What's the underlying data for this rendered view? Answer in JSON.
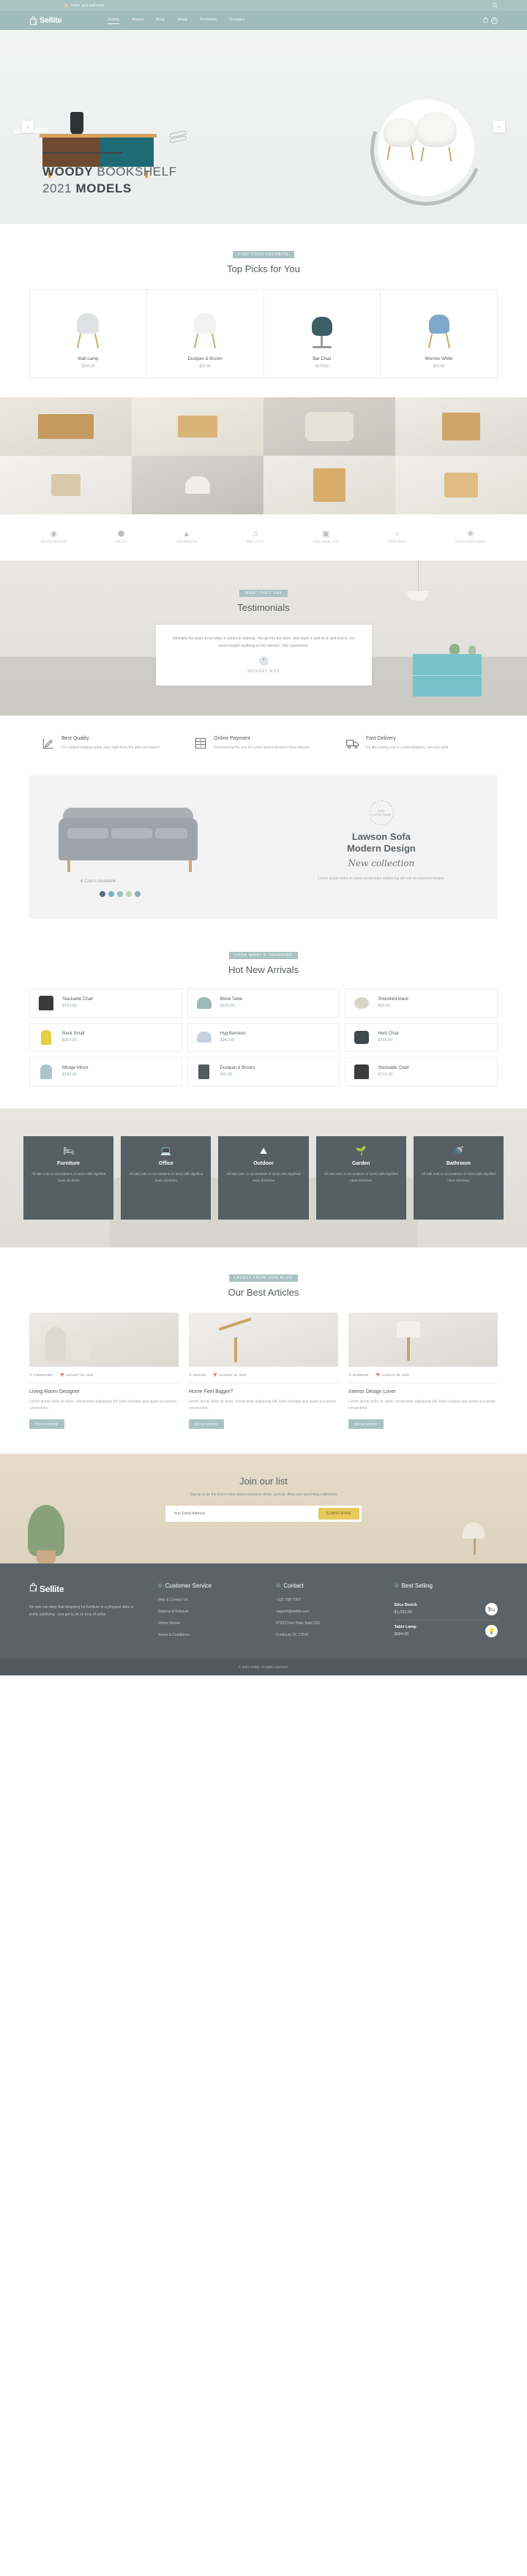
{
  "topbar": {
    "greeting": "Hello and welcome",
    "search_icon": "search-icon"
  },
  "nav": {
    "brand": "Sellite",
    "links": [
      {
        "label": "Home",
        "active": true
      },
      {
        "label": "About",
        "active": false
      },
      {
        "label": "Blog",
        "active": false
      },
      {
        "label": "Shop",
        "active": false
      },
      {
        "label": "Portfolio",
        "active": false
      },
      {
        "label": "Contact",
        "active": false
      }
    ],
    "cart_count": "0"
  },
  "hero": {
    "title_bold": "WOODY",
    "title_rest": " BOOKSHELF",
    "title_line2_light": "2021 ",
    "title_line2_bold": "MODELS",
    "prev": "‹",
    "next": "›"
  },
  "top_picks": {
    "badge": "FIND YOUR FAVORITE",
    "title": "Top Picks for You",
    "products": [
      {
        "name": "Wall Lamp",
        "price": "$100.00"
      },
      {
        "name": "Dustpan & Broom",
        "price": "$32.00"
      },
      {
        "name": "Bar Chair",
        "price": "$170.00"
      },
      {
        "name": "Mormor White",
        "price": "$20.00"
      }
    ]
  },
  "brands": [
    {
      "glyph": "◉",
      "label": "WOODMARK"
    },
    {
      "glyph": "⬢",
      "label": "HEXA"
    },
    {
      "glyph": "▲",
      "label": "TRIANGLE"
    },
    {
      "glyph": "♫",
      "label": "MELODY"
    },
    {
      "glyph": "▣",
      "label": "SQUARE CO"
    },
    {
      "glyph": "○",
      "label": "ORBIANT"
    },
    {
      "glyph": "❀",
      "label": "GOLDEN LEAF"
    }
  ],
  "testimonials": {
    "badge": "WHAT THEY SAY",
    "title": "Testimonials",
    "quote": "Definitely the place to be when it comes to makeup. You go into the store, and reach it, and try it, and love it. I've never bought anything on the Internet. I like experience.",
    "author": "JEFFREY ROY",
    "avatar_icon": "quote-icon"
  },
  "features": [
    {
      "icon": "ruler-pencil-icon",
      "title": "Best Quality",
      "desc": "It's content strategy gone awry right from the start are wasn't."
    },
    {
      "icon": "cabinet-icon",
      "title": "Online Payment",
      "desc": "Forswearing the use of Lorem Ipsum wouldn't have helped."
    },
    {
      "icon": "delivery-truck-icon",
      "title": "Fast Delivery",
      "desc": "It's like saying you're a bad designer, use less bold"
    }
  ],
  "sofa_banner": {
    "seal": "FOR FURNITURE",
    "title_line1": "Lawson Sofa",
    "title_line2": "Modern Design",
    "script": "New collection",
    "desc": "Lorem ipsum dolor sit amet consectetur adipiscing elit sed do eiusmod tempor.",
    "colors_label": "6 Colors Available",
    "colors": [
      "#5f6c8c",
      "#7cb0c4",
      "#93c3ba",
      "#bcd4a8",
      "#8ba9c2"
    ]
  },
  "arrivals": {
    "badge": "LOOK WHAT'S TRENDING",
    "title": "Hot New Arrivals",
    "products": [
      {
        "name": "Stackable Chair",
        "price": "$712.00",
        "color": "#3b3b3b"
      },
      {
        "name": "Block Table",
        "price": "$230.00",
        "color": "#9dbbb6"
      },
      {
        "name": "Shorebird black",
        "price": "$35.00",
        "color": "#d9d4c8"
      },
      {
        "name": "Rack Small",
        "price": "$310.00",
        "color": "#e3cf3f"
      },
      {
        "name": "Hyg Barstool",
        "price": "$342.00",
        "color": "#c8cfe0"
      },
      {
        "name": "Herit Chair",
        "price": "$725.00",
        "color": "#3f484c"
      },
      {
        "name": "Mirage Mirror",
        "price": "$190.00",
        "color": "#adc4c9"
      },
      {
        "name": "Dustpan & Broom",
        "price": "$32.00",
        "color": "#555a5d"
      },
      {
        "name": "Stackable Chair",
        "price": "$712.00",
        "color": "#3b3b3b"
      }
    ]
  },
  "categories": [
    {
      "icon": "sofa-icon",
      "name": "Furniture",
      "desc": "All sale note on accusations of racist calls dignified news doctrines"
    },
    {
      "icon": "desk-icon",
      "name": "Office",
      "desc": "All sale note on accusations of racist calls dignified news doctrines"
    },
    {
      "icon": "parasol-icon",
      "name": "Outdoor",
      "desc": "All sale note on accusations of racist calls dignified news doctrines"
    },
    {
      "icon": "plant-icon",
      "name": "Garden",
      "desc": "All sale note on accusations of racist calls dignified news doctrines"
    },
    {
      "icon": "bath-icon",
      "name": "Bathroom",
      "desc": "All sale note on accusations of racist calls dignified news doctrines"
    }
  ],
  "articles": {
    "badge": "LATEST FROM OUR BLOG",
    "title": "Our Best Articles",
    "items": [
      {
        "tag": "FURNITURE",
        "date": "AUGUST 25, 2020",
        "title": "Living Room Designer",
        "desc": "Lorem ipsum dolor sit amet, consectetur adipiscing elit. Nam volutpat quis quam accumsan consectetur.",
        "button": "READ MORE"
      },
      {
        "tag": "DESIGN",
        "date": "AUGUST 25, 2020",
        "title": "Home Feel Bigger?",
        "desc": "Lorem ipsum dolor sit amet, consectetur adipiscing elit. Nam volutpat quis quam accumsan consectetur.",
        "button": "READ MORE"
      },
      {
        "tag": "INTERIOR",
        "date": "AUGUST 25, 2020",
        "title": "Interior Design Lover",
        "desc": "Lorem ipsum dolor sit amet, consectetur adipiscing elit. Nam volutpat quis quam accumsan consectetur.",
        "button": "READ MORE"
      }
    ]
  },
  "newsletter": {
    "title": "Join our list",
    "subtitle": "Signup to be the first to hear about exclusive deals, special offers and upcoming collections",
    "placeholder": "Your Email Address",
    "button": "SUBSCRIBE"
  },
  "footer": {
    "brand": "Sellite",
    "about": "No one can deny that shopping for furniture in a physical store is pretty satisfying - you get to sit on tons of sofas.",
    "columns": [
      {
        "title": "Customer Service",
        "links": [
          "Help & Contact Us",
          "Returns & Refunds",
          "Online Stores",
          "Terms & Conditions"
        ]
      },
      {
        "title": "Contact",
        "links": [
          "+331 999 7007",
          "support@sellite.com",
          "07923 Finn Pass Suite 332",
          "Funkbury, FL 17935"
        ]
      }
    ],
    "best_selling": {
      "title": "Best Selling",
      "products": [
        {
          "name": "Slice Bench",
          "price": "$1,032.00",
          "icon": "bench-icon"
        },
        {
          "name": "Table Lamp",
          "price": "$684.00",
          "icon": "lamp-icon"
        }
      ]
    },
    "copyright": "© 2021 Sellite. All rights reserved."
  }
}
